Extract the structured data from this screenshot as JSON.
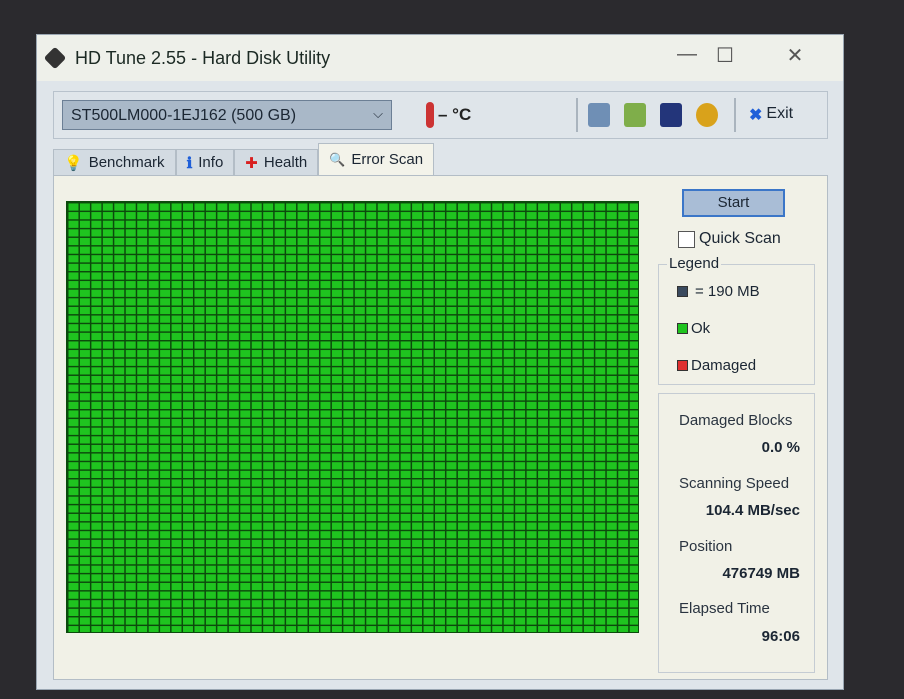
{
  "window": {
    "title": "HD Tune 2.55 - Hard Disk Utility",
    "minimize": "—",
    "maximize": "☐",
    "close": "✕"
  },
  "toolbar": {
    "drive": "ST500LM000-1EJ162 (500 GB)",
    "temperature": "– °C",
    "exit_label": "Exit",
    "exit_icon": "✖",
    "chevron": "⌵"
  },
  "tabs": [
    {
      "label": "Benchmark",
      "icon": "💡"
    },
    {
      "label": "Info",
      "icon": "ℹ"
    },
    {
      "label": "Health",
      "icon": "✚"
    },
    {
      "label": "Error Scan",
      "icon": "🔍"
    }
  ],
  "scan": {
    "start_label": "Start",
    "quick_scan_label": "Quick Scan",
    "quick_scan_checked": false,
    "colors": {
      "ok": "#1fc41f",
      "damaged": "#e03030",
      "block": "#3a4a5e"
    }
  },
  "legend": {
    "title": "Legend",
    "block_size": "= 190 MB",
    "ok": "Ok",
    "damaged": "Damaged"
  },
  "stats": {
    "damaged_blocks_label": "Damaged Blocks",
    "damaged_blocks": "0.0 %",
    "speed_label": "Scanning Speed",
    "speed": "104.4 MB/sec",
    "position_label": "Position",
    "position": "476749 MB",
    "elapsed_label": "Elapsed Time",
    "elapsed": "96:06"
  }
}
